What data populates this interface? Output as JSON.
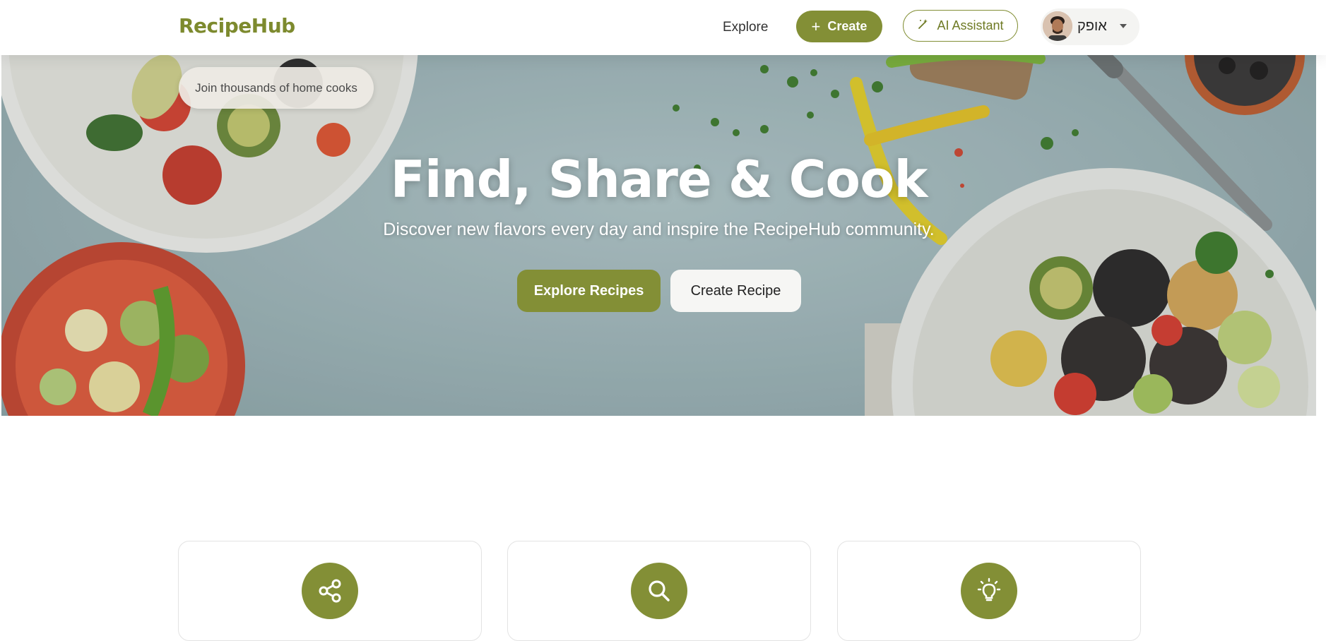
{
  "navbar": {
    "brand": "RecipeHub",
    "explore_label": "Explore",
    "create_label": "Create",
    "ai_label": "AI Assistant",
    "user_name": "אופק"
  },
  "hero": {
    "badge": "Join thousands of home cooks",
    "title": "Find, Share & Cook",
    "subtitle": "Discover new flavors every day and inspire the RecipeHub community.",
    "explore_button": "Explore Recipes",
    "create_button": "Create Recipe"
  },
  "features": [
    {
      "icon": "share-icon"
    },
    {
      "icon": "search-icon"
    },
    {
      "icon": "lightbulb-icon"
    }
  ],
  "colors": {
    "accent": "#838f36",
    "brand": "#7d8a2e",
    "hero_background": "#a7bcbf"
  }
}
